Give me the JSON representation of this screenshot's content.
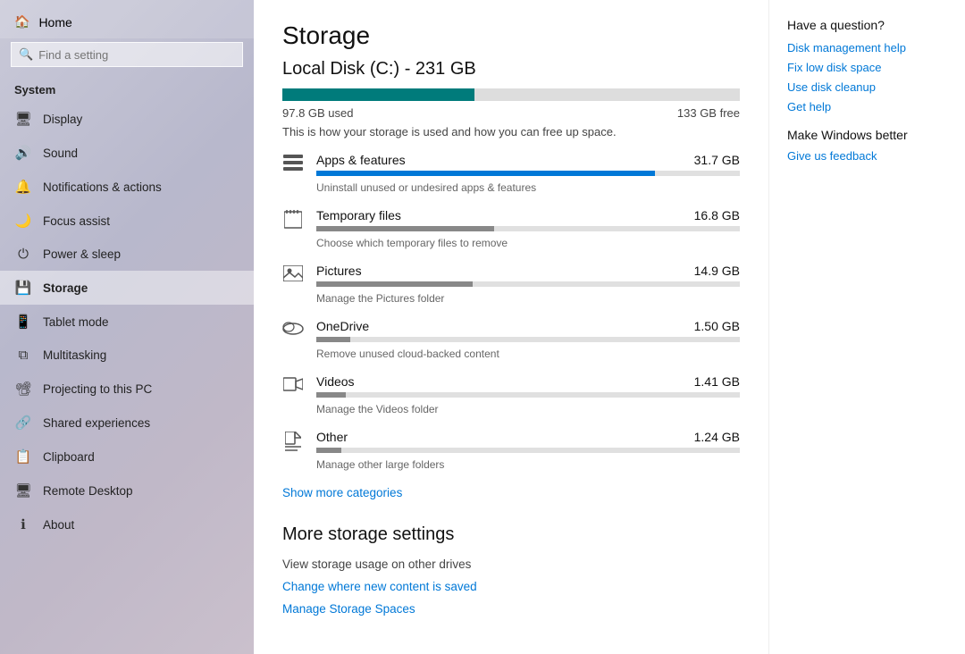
{
  "sidebar": {
    "home_label": "Home",
    "search_placeholder": "Find a setting",
    "section_label": "System",
    "items": [
      {
        "id": "display",
        "label": "Display",
        "icon": "🖥"
      },
      {
        "id": "sound",
        "label": "Sound",
        "icon": "🔊"
      },
      {
        "id": "notifications",
        "label": "Notifications & actions",
        "icon": "🔔"
      },
      {
        "id": "focus",
        "label": "Focus assist",
        "icon": "🌙"
      },
      {
        "id": "power",
        "label": "Power & sleep",
        "icon": "⏻"
      },
      {
        "id": "storage",
        "label": "Storage",
        "icon": "💾"
      },
      {
        "id": "tablet",
        "label": "Tablet mode",
        "icon": "📱"
      },
      {
        "id": "multitasking",
        "label": "Multitasking",
        "icon": "⧉"
      },
      {
        "id": "projecting",
        "label": "Projecting to this PC",
        "icon": "📽"
      },
      {
        "id": "shared",
        "label": "Shared experiences",
        "icon": "🔗"
      },
      {
        "id": "clipboard",
        "label": "Clipboard",
        "icon": "📋"
      },
      {
        "id": "remote",
        "label": "Remote Desktop",
        "icon": "🖥"
      },
      {
        "id": "about",
        "label": "About",
        "icon": "ℹ"
      }
    ]
  },
  "main": {
    "page_title": "Storage",
    "disk_title": "Local Disk (C:) - 231 GB",
    "used_label": "97.8 GB used",
    "free_label": "133 GB free",
    "bar_percent": 42,
    "description": "This is how your storage is used and how you can free up space.",
    "categories": [
      {
        "id": "apps",
        "name": "Apps & features",
        "size": "31.7 GB",
        "desc": "Uninstall unused or undesired apps & features",
        "bar_percent": 80,
        "icon": "apps"
      },
      {
        "id": "temp",
        "name": "Temporary files",
        "size": "16.8 GB",
        "desc": "Choose which temporary files to remove",
        "bar_percent": 42,
        "icon": "temp"
      },
      {
        "id": "pictures",
        "name": "Pictures",
        "size": "14.9 GB",
        "desc": "Manage the Pictures folder",
        "bar_percent": 37,
        "icon": "pictures"
      },
      {
        "id": "onedrive",
        "name": "OneDrive",
        "size": "1.50 GB",
        "desc": "Remove unused cloud-backed content",
        "bar_percent": 8,
        "icon": "onedrive"
      },
      {
        "id": "videos",
        "name": "Videos",
        "size": "1.41 GB",
        "desc": "Manage the Videos folder",
        "bar_percent": 7,
        "icon": "videos"
      },
      {
        "id": "other",
        "name": "Other",
        "size": "1.24 GB",
        "desc": "Manage other large folders",
        "bar_percent": 6,
        "icon": "other"
      }
    ],
    "show_more_label": "Show more categories",
    "more_storage_title": "More storage settings",
    "view_usage_label": "View storage usage on other drives",
    "change_content_label": "Change where new content is saved",
    "manage_spaces_label": "Manage Storage Spaces"
  },
  "right_panel": {
    "question": "Have a question?",
    "links": [
      "Disk management help",
      "Fix low disk space",
      "Use disk cleanup",
      "Get help"
    ],
    "make_better": "Make Windows better",
    "feedback_label": "Give us feedback"
  }
}
